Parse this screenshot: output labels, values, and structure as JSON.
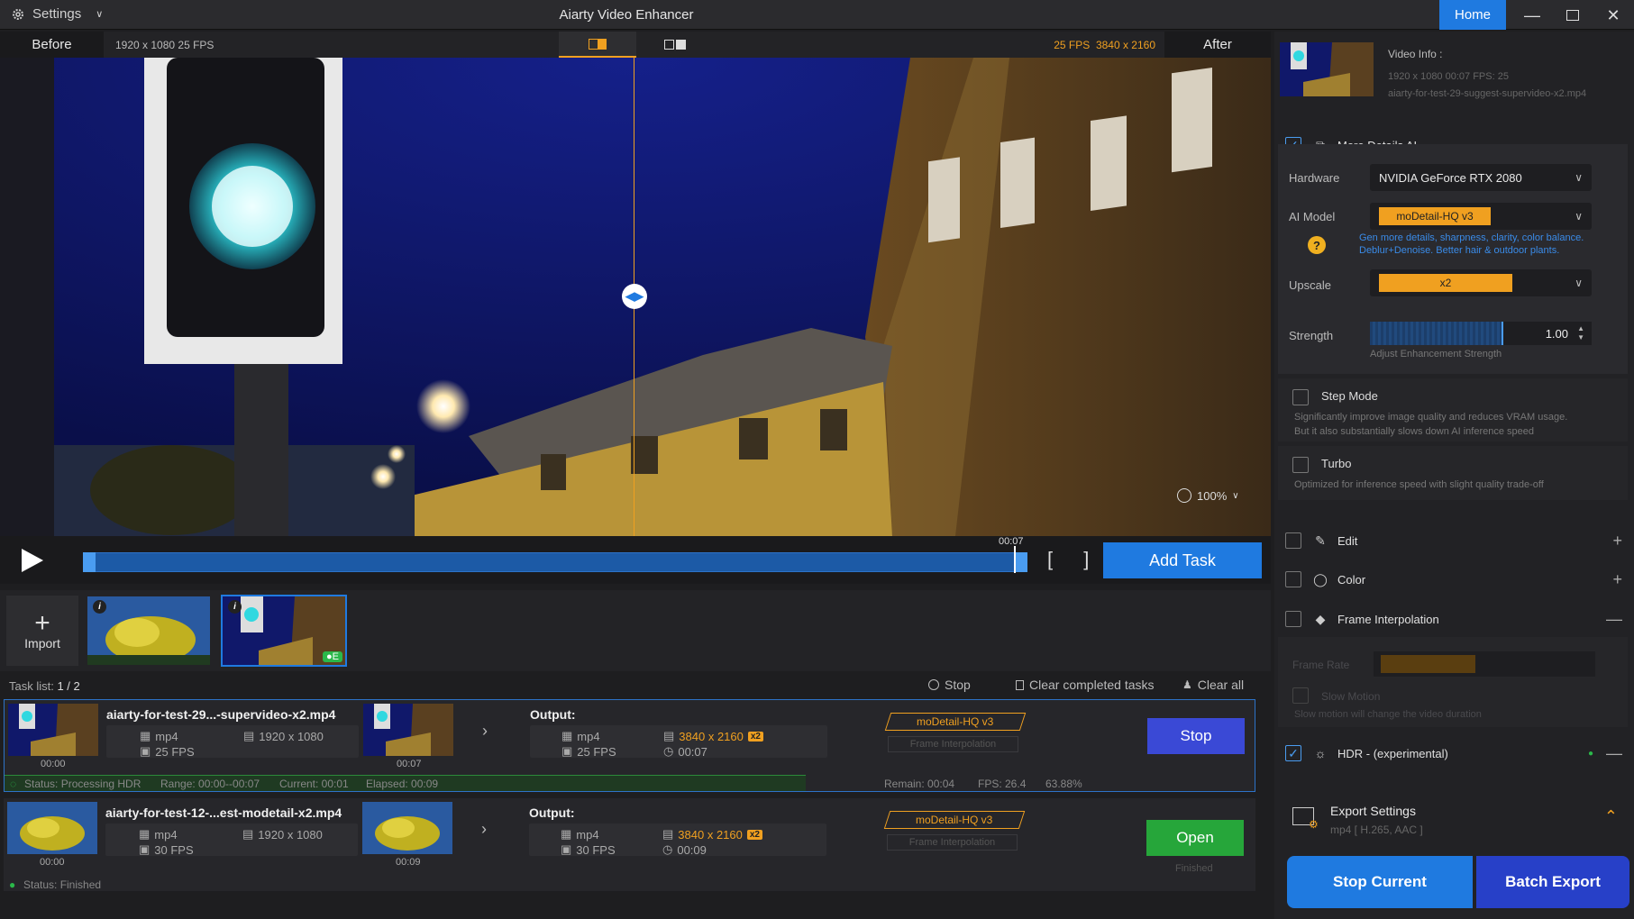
{
  "titlebar": {
    "settings_label": "Settings",
    "app_title": "Aiarty Video Enhancer",
    "home_label": "Home"
  },
  "preview": {
    "before_label": "Before",
    "after_label": "After",
    "source_info": "1920 x 1080  25 FPS",
    "output_fps": "25 FPS",
    "output_res": "3840 x 2160",
    "zoom_level": "100%"
  },
  "timeline": {
    "current_time": "00:07",
    "add_task_label": "Add Task"
  },
  "thumbs": {
    "import_label": "Import",
    "badge_info": "i",
    "badge_e": "●E"
  },
  "tasklist": {
    "label": "Task list:",
    "count": "1 / 2",
    "stop_label": "Stop",
    "clear_completed_label": "Clear completed tasks",
    "clear_all_label": "Clear all",
    "output_label": "Output:",
    "tasks": [
      {
        "name": "aiarty-for-test-29...-supervideo-x2.mp4",
        "format": "mp4",
        "resolution": "1920 x 1080",
        "fps": "25 FPS",
        "in_time": "00:00",
        "out_time": "00:07",
        "out_format": "mp4",
        "out_resolution": "3840 x 2160",
        "out_scale": "x2",
        "out_fps": "25 FPS",
        "out_duration": "00:07",
        "model": "moDetail-HQ  v3",
        "fi_tag": "Frame Interpolation",
        "button": "Stop",
        "status": "Status: Processing HDR",
        "range": "Range: 00:00--00:07",
        "current": "Current: 00:01",
        "elapsed": "Elapsed: 00:09",
        "remain": "Remain: 00:04",
        "fps_rate": "FPS: 26.4",
        "percent": "63.88%",
        "progress": 0.64
      },
      {
        "name": "aiarty-for-test-12-...est-modetail-x2.mp4",
        "format": "mp4",
        "resolution": "1920 x 1080",
        "fps": "30 FPS",
        "in_time": "00:00",
        "out_time": "00:09",
        "out_format": "mp4",
        "out_resolution": "3840 x 2160",
        "out_scale": "x2",
        "out_fps": "30 FPS",
        "out_duration": "00:09",
        "model": "moDetail-HQ  v3",
        "fi_tag": "Frame Interpolation",
        "button": "Open",
        "finished_label": "Finished",
        "status": "Status: Finished"
      }
    ]
  },
  "panel": {
    "video_info_title": "Video Info :",
    "video_info_line1": "1920 x 1080  00:07   FPS: 25",
    "video_info_file": "aiarty-for-test-29-suggest-supervideo-x2.mp4",
    "more_details_label": "More Details AI",
    "hardware_label": "Hardware",
    "hardware_value": "NVIDIA GeForce RTX 2080",
    "ai_model_label": "AI Model",
    "ai_model_value": "moDetail-HQ  v3",
    "ai_model_desc": "Gen more details, sharpness, clarity, color balance. Deblur+Denoise. Better hair & outdoor plants.",
    "upscale_label": "Upscale",
    "upscale_value": "x2",
    "strength_label": "Strength",
    "strength_value": "1.00",
    "strength_hint": "Adjust Enhancement Strength",
    "step_mode_label": "Step Mode",
    "step_mode_desc1": "Significantly improve image quality and reduces VRAM usage.",
    "step_mode_desc2": "But it also substantially slows down AI inference speed",
    "turbo_label": "Turbo",
    "turbo_desc": "Optimized for inference speed with slight quality trade-off",
    "edit_label": "Edit",
    "color_label": "Color",
    "frame_interp_label": "Frame Interpolation",
    "frame_rate_label": "Frame Rate",
    "slow_motion_label": "Slow Motion",
    "slow_motion_desc": "Slow motion will change the video duration",
    "hdr_label": "HDR - (experimental)",
    "export_settings_label": "Export Settings",
    "export_settings_value": "mp4 [ H.265, AAC ]",
    "stop_current_label": "Stop Current",
    "batch_export_label": "Batch Export"
  },
  "colors": {
    "accent_blue": "#1f7ae0",
    "accent_orange": "#f0a020",
    "stop_button": "#3a49d6",
    "open_button": "#26a63a"
  }
}
